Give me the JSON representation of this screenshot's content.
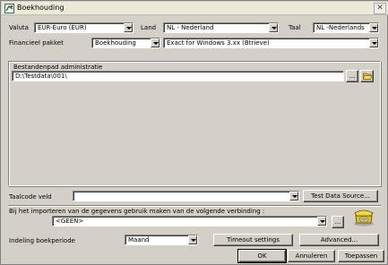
{
  "window": {
    "title": "Boekhouding",
    "close_glyph": "✕"
  },
  "row1": {
    "valuta_label": "Valuta",
    "valuta_value": "EUR-Euro (EUR)",
    "land_label": "Land",
    "land_value": "NL - Nederland",
    "taal_label": "Taal",
    "taal_value": "NL -Nederlands"
  },
  "row2": {
    "pakket_label": "Financieel pakket",
    "pakket_value": "Boekhouding",
    "versie_value": "Exact for Windows 3.xx (Btrieve)"
  },
  "bestand": {
    "group_label": "Bestandenpad administratie",
    "path_value": "D:\\Testdata\\001\\",
    "browse_label": "...",
    "folder_icon": "folder-open-icon"
  },
  "taalcode": {
    "label": "Taalcode veld",
    "value": "",
    "test_button": "Test Data Source..."
  },
  "import": {
    "label": "Bij het importeren van de gegevens gebruik maken van de volgende verbinding :",
    "value": "<GEEN>",
    "browse_label": "...",
    "icon": "phone-connection-icon"
  },
  "indeling": {
    "label": "Indeling boekperiode",
    "value": "Maand",
    "timeout_button": "Timeout settings",
    "advanced_button": "Advanced..."
  },
  "footer": {
    "ok": "OK",
    "cancel": "Annuleren",
    "apply": "Toepassen"
  }
}
